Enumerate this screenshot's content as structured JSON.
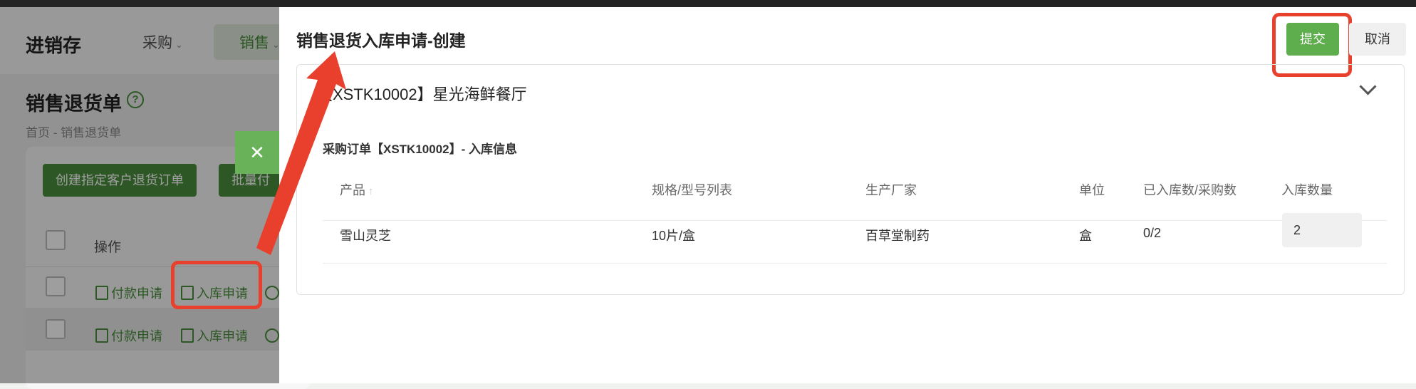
{
  "background": {
    "app_title": "进销存",
    "nav": {
      "purchase": "采购",
      "sales": "销售"
    },
    "page_title": "销售退货单",
    "breadcrumb": "首页 - 销售退货单",
    "buttons": {
      "create": "创建指定客户退货订单",
      "batch": "批量付"
    },
    "table": {
      "op_header": "操作",
      "rows": [
        {
          "pay": "付款申请",
          "instock": "入库申请"
        },
        {
          "pay": "付款申请",
          "instock": "入库申请"
        }
      ]
    },
    "toast_icon": "close-icon"
  },
  "drawer": {
    "title": "销售退货入库申请-创建",
    "submit_label": "提交",
    "cancel_label": "取消",
    "panel": {
      "title": "【XSTK10002】星光海鲜餐厅",
      "subtitle": "采购订单【XSTK10002】- 入库信息",
      "columns": [
        "产品",
        "规格/型号列表",
        "生产厂家",
        "单位",
        "已入库数/采购数",
        "入库数量"
      ],
      "rows": [
        {
          "product": "雪山灵芝",
          "spec": "10片/盒",
          "maker": "百草堂制药",
          "unit": "盒",
          "progress": "0/2",
          "qty": "2"
        }
      ]
    }
  },
  "colors": {
    "accent": "#5fae4e",
    "highlight": "#e8402d"
  }
}
